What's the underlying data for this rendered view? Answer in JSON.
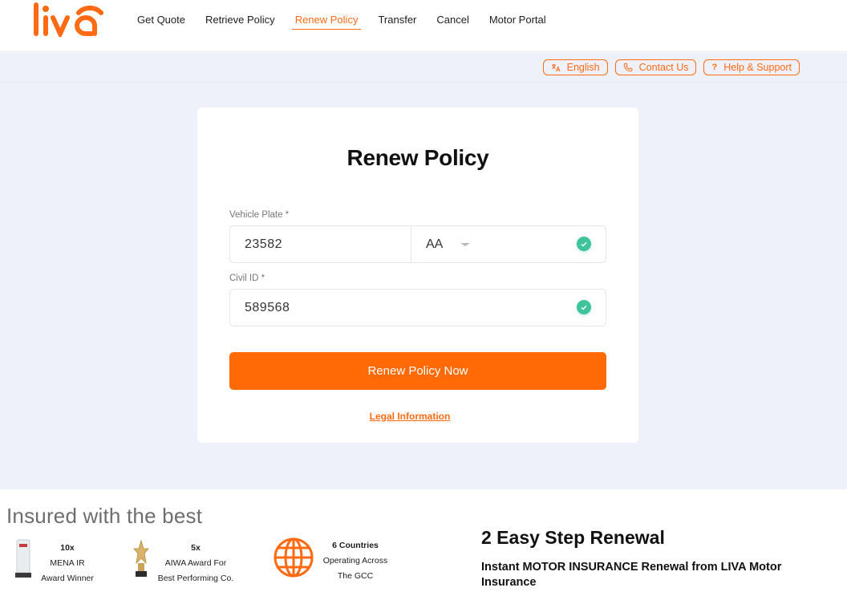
{
  "brand": {
    "logo_text": "liva",
    "accent": "#ff6a13",
    "success": "#3ec39a"
  },
  "nav": {
    "items": [
      {
        "label": "Get Quote"
      },
      {
        "label": "Retrieve Policy"
      },
      {
        "label": "Renew Policy",
        "active": true
      },
      {
        "label": "Transfer"
      },
      {
        "label": "Cancel"
      },
      {
        "label": "Motor Portal"
      }
    ]
  },
  "utility": {
    "language": {
      "label": "English",
      "icon": "translate-icon"
    },
    "contact": {
      "label": "Contact Us",
      "icon": "phone-icon"
    },
    "help": {
      "label": "Help & Support",
      "icon": "question-icon"
    }
  },
  "form": {
    "title": "Renew Policy",
    "vehicle_plate_label": "Vehicle Plate *",
    "vehicle_plate_number": "23582",
    "vehicle_plate_code": "AA",
    "civil_id_label": "Civil ID *",
    "civil_id_value": "589568",
    "submit_label": "Renew Policy Now",
    "legal_link": "Legal Information"
  },
  "insured": {
    "title": "Insured with the best",
    "awards": [
      {
        "count": "10x",
        "line1": "MENA IR",
        "line2": "Award Winner"
      },
      {
        "count": "5x",
        "line1": "AIWA Award For",
        "line2": "Best Performing Co."
      },
      {
        "count": "6 Countries",
        "line1": "Operating Across",
        "line2": "The GCC"
      }
    ]
  },
  "renewal": {
    "title": "2 Easy Step Renewal",
    "subtitle": "Instant MOTOR INSURANCE Renewal from LIVA Motor Insurance"
  }
}
